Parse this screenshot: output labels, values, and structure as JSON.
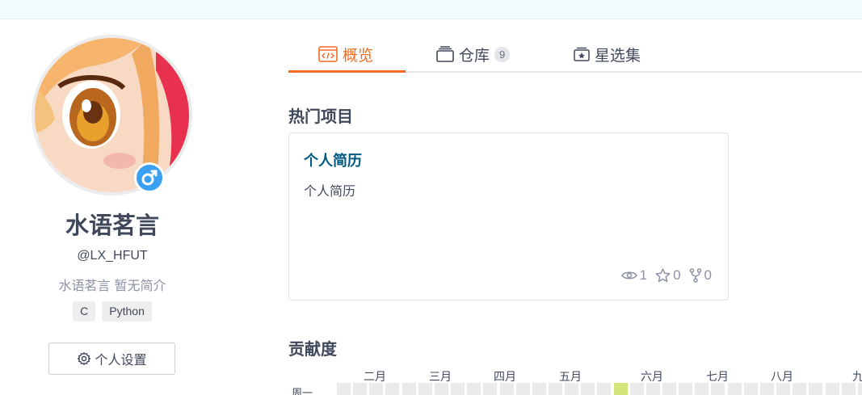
{
  "profile": {
    "name": "水语茗言",
    "handle": "@LX_HFUT",
    "bio": "水语茗言 暂无简介",
    "languages": [
      "C",
      "Python"
    ],
    "settings_label": "个人设置",
    "gender_symbol": "♂"
  },
  "tabs": [
    {
      "label": "概览",
      "icon": "code-icon"
    },
    {
      "label": "仓库",
      "icon": "repo-icon",
      "count": "9"
    },
    {
      "label": "星选集",
      "icon": "star-collection-icon"
    }
  ],
  "popular": {
    "title": "热门项目",
    "project": {
      "name": "个人简历",
      "description": "个人简历",
      "watches": "1",
      "stars": "0",
      "forks": "0"
    }
  },
  "contribution": {
    "title": "贡献度",
    "months": [
      "二月",
      "三月",
      "四月",
      "五月",
      "六月",
      "七月",
      "八月",
      "九"
    ],
    "weekday": "周一",
    "empty_color": "#ebebeb",
    "active_color": "#d4e57a",
    "active_week": 17
  },
  "colors": {
    "accent": "#f36b21",
    "link": "#005980",
    "badge": "#3ba0f2"
  }
}
